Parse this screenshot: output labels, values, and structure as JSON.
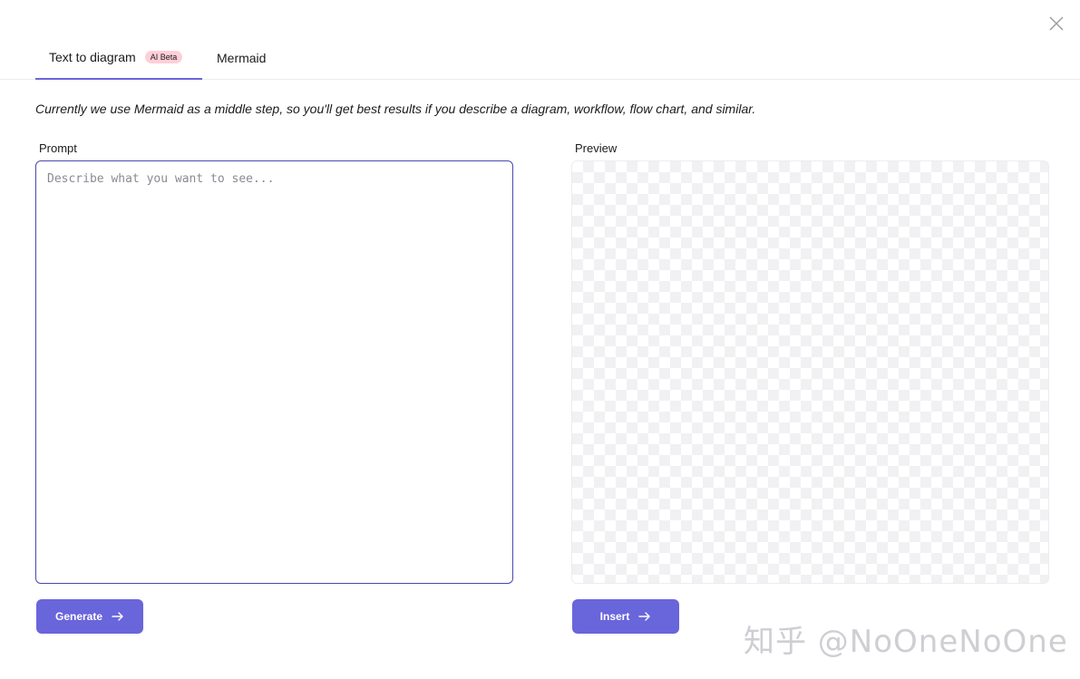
{
  "dialog": {
    "close_icon": "close-icon"
  },
  "tabs": [
    {
      "label": "Text to diagram",
      "badge": "AI Beta",
      "active": true
    },
    {
      "label": "Mermaid",
      "active": false
    }
  ],
  "description": "Currently we use Mermaid as a middle step, so you'll get best results if you describe a diagram, workflow, flow chart, and similar.",
  "prompt": {
    "label": "Prompt",
    "placeholder": "Describe what you want to see...",
    "value": ""
  },
  "preview": {
    "label": "Preview"
  },
  "buttons": {
    "generate": "Generate",
    "insert": "Insert",
    "arrow_icon": "arrow-right-icon"
  },
  "watermark": "知乎 @NoOneNoOne",
  "colors": {
    "accent": "#6965db",
    "badge_bg": "#ffcfd8",
    "focus_border": "#4a47b1"
  }
}
